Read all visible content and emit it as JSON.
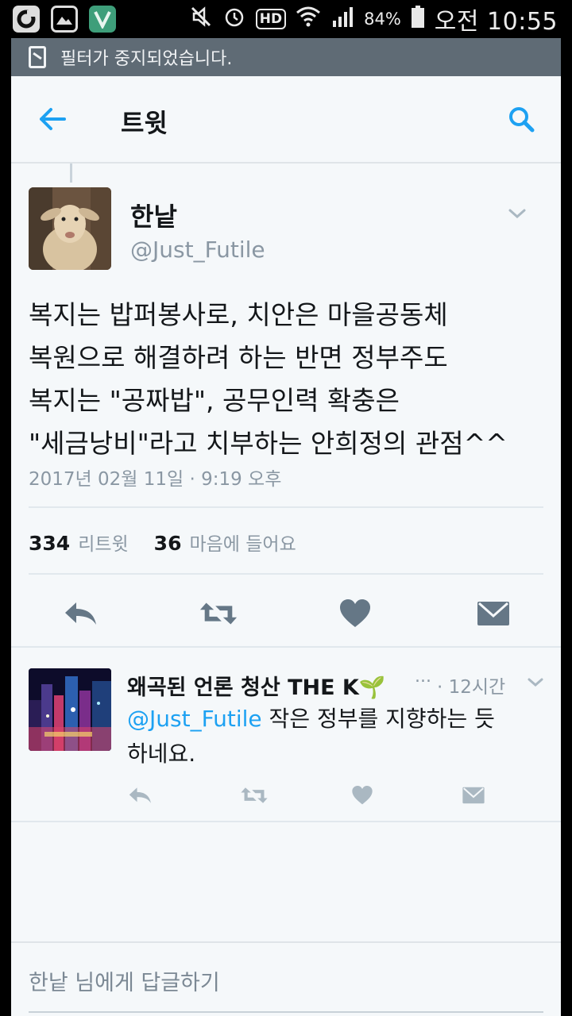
{
  "status_bar": {
    "battery": "84%",
    "time": "오전 10:55",
    "hd_label": "HD",
    "icons": [
      "g-app-icon",
      "image-icon",
      "v-app-icon",
      "mute-icon",
      "alarm-icon",
      "hd-voice-icon",
      "wifi-icon",
      "signal-icon",
      "battery-icon"
    ]
  },
  "notice": {
    "text": "필터가 중지되었습니다."
  },
  "appbar": {
    "title": "트윗"
  },
  "tweet": {
    "author_name": "한낱",
    "author_handle": "@Just_Futile",
    "text_lines": [
      "복지는 밥퍼봉사로, 치안은 마을공동체",
      "복원으로 해결하려 하는 반면 정부주도",
      "복지는 \"공짜밥\", 공무인력 확충은",
      "\"세금낭비\"라고 치부하는 안희정의 관점^^"
    ],
    "date": "2017년 02월 11일 · 9:19 오후",
    "retweet_count": "334",
    "retweet_label": "리트윗",
    "like_count": "36",
    "like_label": "마음에 들어요"
  },
  "reply": {
    "author_name": "왜곡된 언론 청산 THE K🌱",
    "ellipsis": "...",
    "time": "· 12시간",
    "mention": "@Just_Futile",
    "text_rest": " 작은 정부를 지향하는 듯",
    "text_line2": "하네요."
  },
  "compose": {
    "placeholder": "한낱 님에게 답글하기"
  },
  "colors": {
    "accent": "#1da1f2",
    "icon_grey": "#657786",
    "background": "#f5f8fa",
    "notice_bar": "#5f6b75"
  }
}
